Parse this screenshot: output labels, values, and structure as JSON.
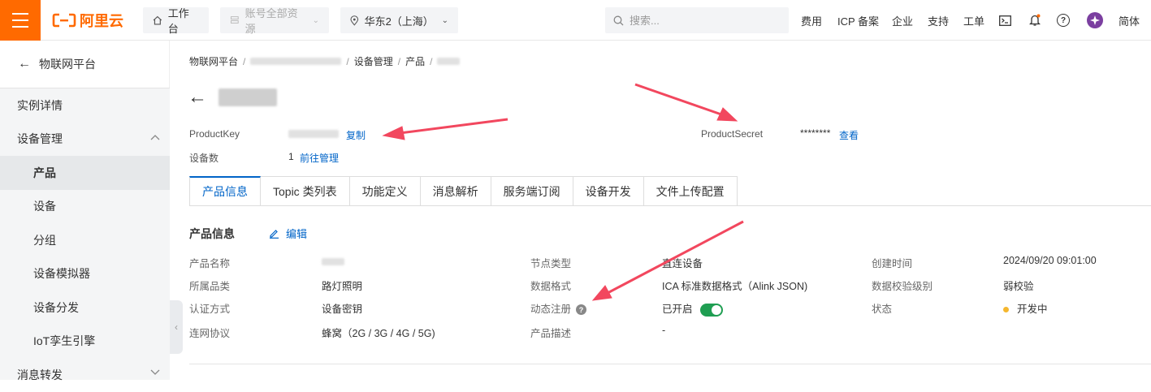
{
  "topbar": {
    "logo_text": "阿里云",
    "workbench": "工作台",
    "resources": "账号全部资源",
    "region": "华东2（上海）",
    "search_placeholder": "搜索...",
    "links": [
      "费用",
      "ICP 备案",
      "企业",
      "支持",
      "工单"
    ],
    "lang": "简体",
    "accent": "#ff6a00"
  },
  "sidebar": {
    "back_label": "物联网平台",
    "items": [
      {
        "label": "实例详情",
        "level": 1
      },
      {
        "label": "设备管理",
        "level": 1,
        "expanded": true
      },
      {
        "label": "产品",
        "level": 2,
        "active": true
      },
      {
        "label": "设备",
        "level": 2
      },
      {
        "label": "分组",
        "level": 2
      },
      {
        "label": "设备模拟器",
        "level": 2
      },
      {
        "label": "设备分发",
        "level": 2
      },
      {
        "label": "IoT孪生引擎",
        "level": 2
      },
      {
        "label": "消息转发",
        "level": 1,
        "expanded": false
      }
    ]
  },
  "breadcrumb": [
    "物联网平台",
    "设备管理",
    "产品"
  ],
  "header": {
    "product_key_label": "ProductKey",
    "copy_label": "复制",
    "product_secret_label": "ProductSecret",
    "product_secret_value": "********",
    "view_label": "查看",
    "device_count_label": "设备数",
    "device_count": "1",
    "manage_link": "前往管理"
  },
  "tabs": [
    "产品信息",
    "Topic 类列表",
    "功能定义",
    "消息解析",
    "服务端订阅",
    "设备开发",
    "文件上传配置"
  ],
  "info": {
    "section_title": "产品信息",
    "edit_label": "编辑",
    "rows": [
      {
        "l1": "产品名称",
        "v1": "",
        "l2": "节点类型",
        "v2": "直连设备",
        "l3": "创建时间",
        "v3": "2024/09/20 09:01:00"
      },
      {
        "l1": "所属品类",
        "v1": "路灯照明",
        "l2": "数据格式",
        "v2": "ICA 标准数据格式（Alink JSON)",
        "l3": "数据校验级别",
        "v3": "弱校验"
      },
      {
        "l1": "认证方式",
        "v1": "设备密钥",
        "l2": "动态注册",
        "v2": "已开启",
        "l3": "状态",
        "v3": "开发中"
      },
      {
        "l1": "连网协议",
        "v1": "蜂窝（2G / 3G / 4G / 5G)",
        "l2": "产品描述",
        "v2": "-",
        "l3": "",
        "v3": ""
      }
    ]
  },
  "colors": {
    "link": "#0064c8",
    "toggle_on": "#1f9e52",
    "status_dev": "#f5b72e",
    "annotation_arrow": "#f2475e"
  }
}
